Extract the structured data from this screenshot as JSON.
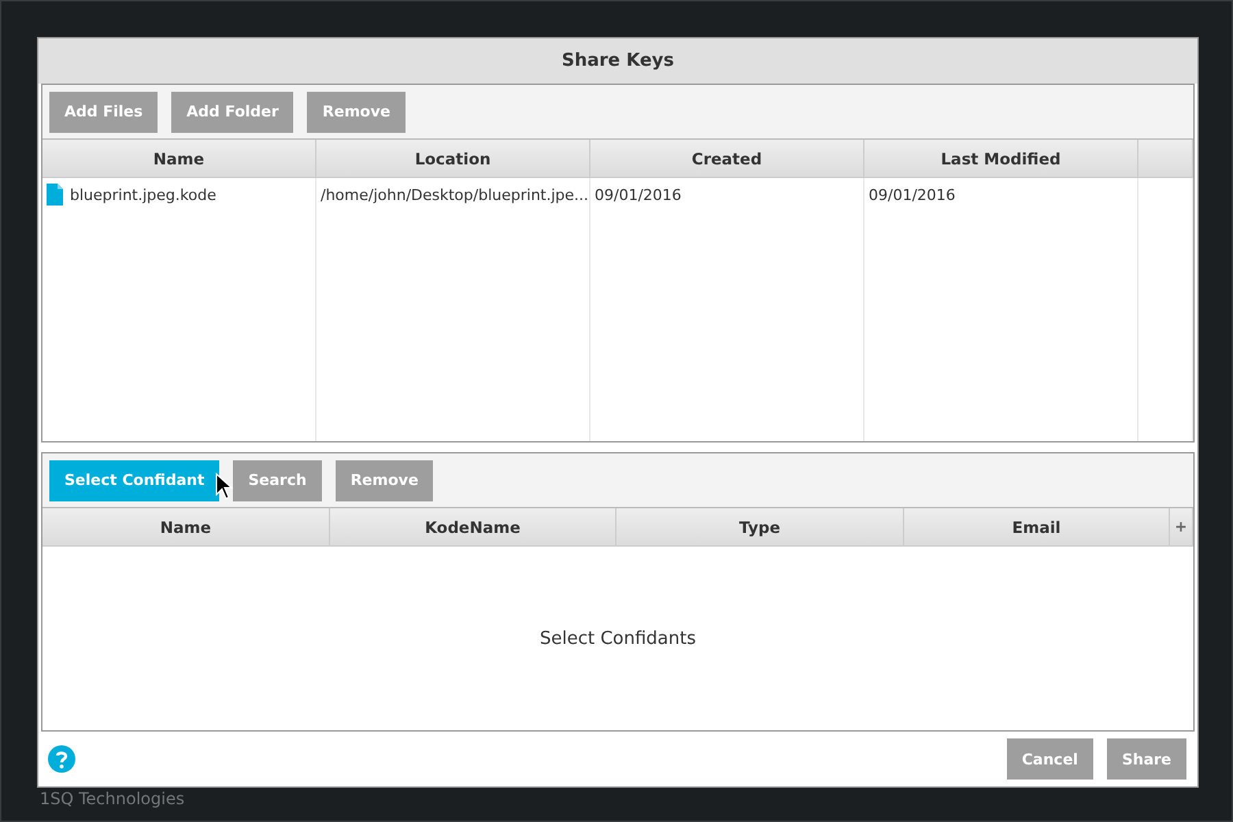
{
  "background": {
    "company": "1SQ Technologies"
  },
  "dialog": {
    "title": "Share Keys",
    "files": {
      "buttons": [
        {
          "label": "Add Files",
          "highlighted": false
        },
        {
          "label": "Add Folder",
          "highlighted": false
        },
        {
          "label": "Remove",
          "highlighted": false
        }
      ],
      "columns": [
        "Name",
        "Location",
        "Created",
        "Last Modified"
      ],
      "rows": [
        {
          "name": "blueprint.jpeg.kode",
          "location": "/home/john/Desktop/blueprint.jpe...",
          "created": "09/01/2016",
          "modified": "09/01/2016"
        }
      ]
    },
    "confidants": {
      "buttons": [
        {
          "label": "Select Confidant",
          "highlighted": true
        },
        {
          "label": "Search",
          "highlighted": false
        },
        {
          "label": "Remove",
          "highlighted": false
        }
      ],
      "columns": [
        "Name",
        "KodeName",
        "Type",
        "Email"
      ],
      "add_column": "+",
      "empty_message": "Select Confidants"
    },
    "footer": {
      "buttons": [
        "Cancel",
        "Share"
      ]
    }
  }
}
